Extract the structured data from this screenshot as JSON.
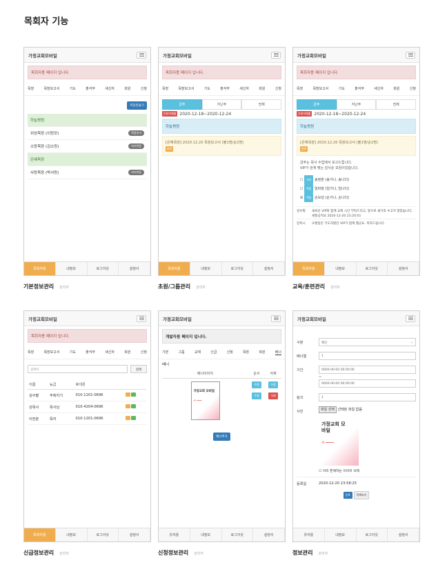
{
  "page_title": "목회자 기능",
  "app_title": "가정교회모바일",
  "admin_alert": "목회자용 페이지 입니다.",
  "dev_alert": "개발자용 페이지 입니다.",
  "menu_items": [
    "목장",
    "목장보고서",
    "기도",
    "출석부",
    "새신자",
    "회원",
    "신청"
  ],
  "footer_pastor": [
    "목회자용",
    "내정보",
    "로그아웃",
    "설정서"
  ],
  "footer_user": [
    "유저용",
    "내정보",
    "로그아웃",
    "설정서"
  ],
  "card1": {
    "caption": "기본정보관리",
    "sub": "관리자",
    "add_button": "목장만들기",
    "groups": [
      {
        "label": "하늘평원",
        "green": true,
        "badge": ""
      },
      {
        "label": "위성목장 (이랑모)",
        "green": false,
        "badge": "목장추가"
      },
      {
        "label": "소망목장 (김소망)",
        "green": false,
        "badge": "자리이동"
      },
      {
        "label": "은혜목장",
        "green": true,
        "badge": ""
      },
      {
        "label": "사랑목장 (박사랑)",
        "green": false,
        "badge": "자리이동"
      }
    ]
  },
  "card2": {
    "caption": "초원/그룹관리",
    "sub": "관리자",
    "tabs": [
      "금주",
      "지난주",
      "전체"
    ],
    "date_tag": "부분미제출",
    "date": "2020-12-18~2020-12-24",
    "info": "하늘평원",
    "report": "[은혜목장] 2020.12.20 목장보고서 (불1명/순2명)",
    "report_badge": "완료"
  },
  "card3": {
    "caption": "교육/훈련관리",
    "sub": "관리자",
    "tabs": [
      "금주",
      "지난주",
      "전체"
    ],
    "date_tag": "부분미제출",
    "date": "2020-12-18~2020-12-24",
    "info": "하늘평원",
    "report": "[은혜목장] 2020.12.20 목장보고서 (불1명/순2명)",
    "report_badge": "완료",
    "text1": "금주는 목사 수업에서 보고드립니다.",
    "text2": "VIP가 관계 맺는 감사순 모임이었습니다.",
    "members": [
      {
        "tag": "리더",
        "tag_color": "#5bc0de",
        "name": "송정훈 (송가나, 송나다)"
      },
      {
        "tag": "목원",
        "tag_color": "#5bc0de",
        "name": "임마정 (임가나, 임나다)"
      },
      {
        "tag": "목원",
        "tag_color": "#5bc0de",
        "name": "손모성 (손가나, 손나다)"
      }
    ],
    "comments": [
      {
        "k": "김수철",
        "v": "새로운 VIP와 함께 교회 시간 부탁드리고, 앞으로 새가족 수고가 많았습니다. 새할공지요 2020-12-20 23:20:01"
      },
      {
        "k": "장목시",
        "v": "오랜동안 기도하였던 VIP가 함께 했군요. 축하드립니다."
      }
    ]
  },
  "card4": {
    "caption": "신급정보관리",
    "sub": "관리자",
    "search_placeholder": "검색어",
    "search_button": "검색",
    "columns": [
      "이름",
      "능급",
      "휴대폰"
    ],
    "rows": [
      {
        "name": "김수팔",
        "rank": "추복지기",
        "phone": "010-1201-0696"
      },
      {
        "name": "강목사",
        "rank": "목사님",
        "phone": "010-4204-0696"
      },
      {
        "name": "이한춘",
        "rank": "목자",
        "phone": "010-1201-0696"
      }
    ]
  },
  "card5": {
    "caption": "신청정보관리",
    "sub": "관리자",
    "nav": [
      "기본",
      "그룹",
      "교재",
      "신급",
      "신청",
      "목장",
      "회원",
      "배너"
    ],
    "section": "배너",
    "columns": [
      "배너이미지",
      "순서",
      "삭제"
    ],
    "banner_title": "가정교회 모바일",
    "btn_up": "수정",
    "btn_del": "삭제",
    "btn_blue2": "수정",
    "add_button": "배너추가"
  },
  "card6": {
    "caption": "정보관리",
    "sub": "관리자",
    "fields": {
      "type_label": "구분",
      "type_value": "메인",
      "order_label": "배너열",
      "order_value": "1",
      "period_label": "기간",
      "start": "0000-00-00 00:00:00",
      "tilde": "~",
      "end": "0000-00-00 00:00:00",
      "link_label": "링크",
      "link_value": "1",
      "image_label": "사진",
      "file_button": "파일 선택",
      "file_text": "선택된 파일 없음",
      "preview_title": "가정교회 모바일",
      "delete_check": "이미 존재하는 이미지 삭제",
      "reg_label": "등록일",
      "reg_value": "2020-12-20 23:58:25",
      "save": "등록",
      "list": "목록보기"
    }
  },
  "colors": {
    "warning": "#f0ad4e",
    "info": "#5bc0de",
    "primary": "#337ab7",
    "danger": "#d9534f",
    "success": "#5cb85c"
  }
}
